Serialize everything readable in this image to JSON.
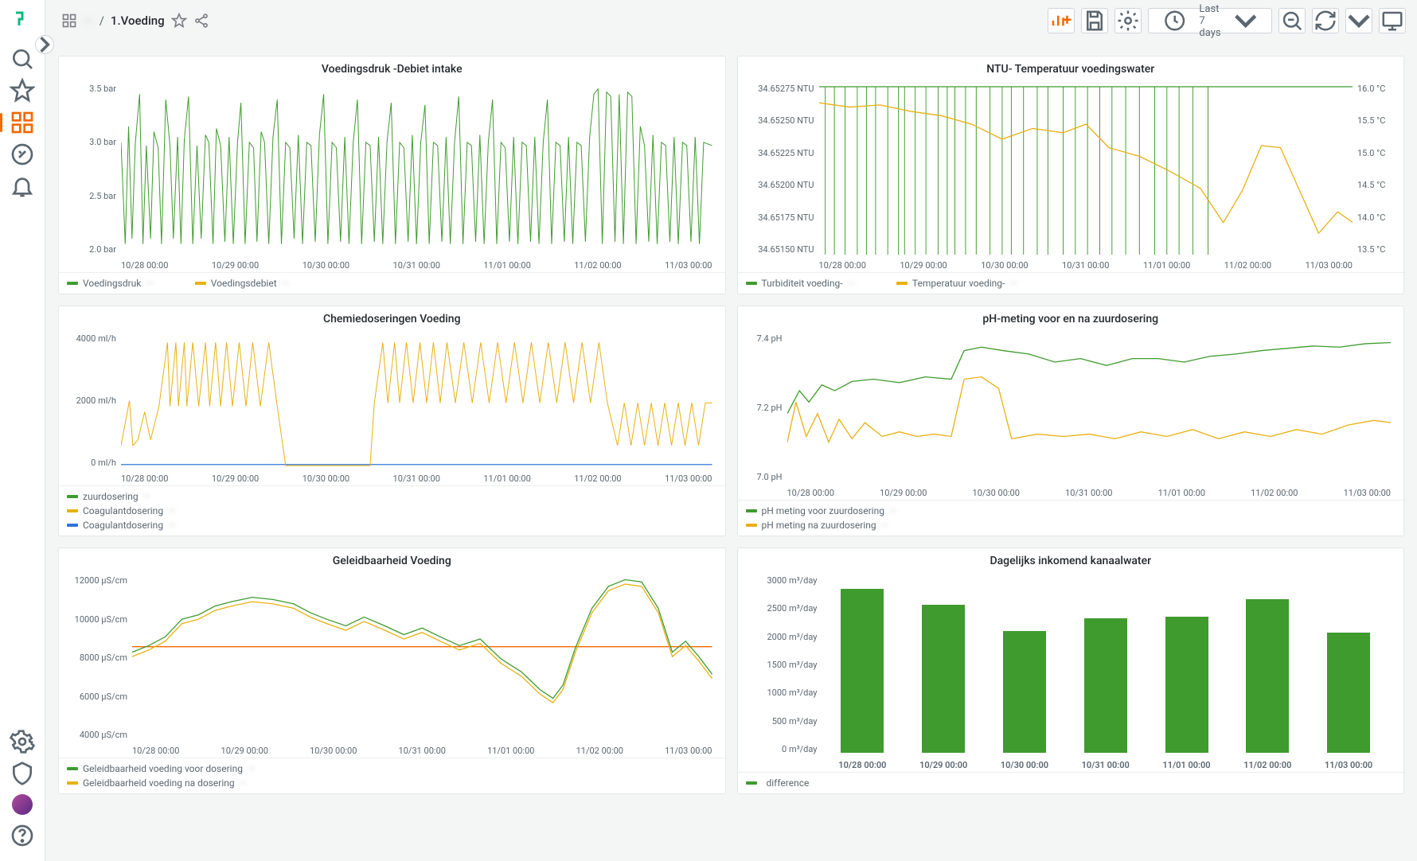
{
  "app": {
    "breadcrumb_root": "Dashboards",
    "breadcrumb_parent": "—",
    "breadcrumb_title": "1.Voeding"
  },
  "toolbar": {
    "time_label": "Last 7 days"
  },
  "sidebar": {
    "items": [
      "search",
      "favorites",
      "dashboards",
      "explore",
      "alerts"
    ],
    "bottom": [
      "admin",
      "shield",
      "profile",
      "help"
    ]
  },
  "x_ticks": [
    "10/28 00:00",
    "10/29 00:00",
    "10/30 00:00",
    "10/31 00:00",
    "11/01 00:00",
    "11/02 00:00",
    "11/03 00:00"
  ],
  "panels": {
    "p1": {
      "title": "Voedingsdruk -Debiet intake",
      "y_ticks": [
        "3.5 bar",
        "3.0 bar",
        "2.5 bar",
        "2.0 bar"
      ],
      "legend": [
        {
          "color": "#3f9b2e",
          "label": "Voedingsdruk",
          "suffix": "—"
        },
        {
          "color": "#e8b012",
          "label": "Voedingsdebiet",
          "suffix": "—"
        }
      ]
    },
    "p2": {
      "title": "NTU- Temperatuur voedingswater",
      "y_ticks_left": [
        "34.65275 NTU",
        "34.65250 NTU",
        "34.65225 NTU",
        "34.65200 NTU",
        "34.65175 NTU",
        "34.65150 NTU"
      ],
      "y_ticks_right": [
        "16.0 °C",
        "15.5 °C",
        "15.0 °C",
        "14.5 °C",
        "14.0 °C",
        "13.5 °C"
      ],
      "legend": [
        {
          "color": "#3f9b2e",
          "label": "Turbiditeit voeding-",
          "suffix": "—"
        },
        {
          "color": "#e8b012",
          "label": "Temperatuur voeding-",
          "suffix": "—"
        }
      ]
    },
    "p3": {
      "title": "Chemiedoseringen Voeding",
      "y_ticks": [
        "4000 ml/h",
        "2000 ml/h",
        "0 ml/h"
      ],
      "legend": [
        {
          "color": "#3f9b2e",
          "label": "zuurdosering",
          "suffix": "—"
        },
        {
          "color": "#e8b012",
          "label": "Coagulantdosering",
          "suffix": "—"
        },
        {
          "color": "#3274d9",
          "label": "Coagulantdosering",
          "suffix": "—"
        }
      ]
    },
    "p4": {
      "title": "pH-meting voor en na zuurdosering",
      "y_ticks": [
        "7.4 pH",
        "7.2 pH",
        "7.0 pH"
      ],
      "legend": [
        {
          "color": "#3f9b2e",
          "label": "pH meting voor zuurdosering",
          "suffix": "—"
        },
        {
          "color": "#e8b012",
          "label": "pH meting na zuurdosering",
          "suffix": "—"
        }
      ]
    },
    "p5": {
      "title": "Geleidbaarheid Voeding",
      "y_ticks": [
        "12000 μS/cm",
        "10000 μS/cm",
        "8000 μS/cm",
        "6000 μS/cm",
        "4000 μS/cm"
      ],
      "legend": [
        {
          "color": "#3f9b2e",
          "label": "Geleidbaarheid voeding voor dosering",
          "suffix": "—"
        },
        {
          "color": "#e8b012",
          "label": "Geleidbaarheid voeding na dosering",
          "suffix": "—"
        }
      ]
    },
    "p6": {
      "title": "Dagelijks inkomend kanaalwater",
      "y_ticks": [
        "3000 m³/day",
        "2500 m³/day",
        "2000 m³/day",
        "1500 m³/day",
        "1000 m³/day",
        "500 m³/day",
        "0 m³/day"
      ],
      "legend": [
        {
          "color": "#3f9b2e",
          "label": "",
          "suffix": "difference"
        }
      ]
    }
  },
  "chart_data": [
    {
      "id": "p1",
      "type": "line",
      "title": "Voedingsdruk -Debiet intake",
      "xlabel": "",
      "ylabel": "bar",
      "ylim": [
        2.0,
        3.5
      ],
      "x_categories": [
        "10/28 00:00",
        "10/29 00:00",
        "10/30 00:00",
        "10/31 00:00",
        "11/01 00:00",
        "11/02 00:00",
        "11/03 00:00"
      ],
      "series": [
        {
          "name": "Voedingsdruk",
          "color": "#3f9b2e",
          "note": "high-frequency pressure data oscillating mostly 2.3–3.2 bar",
          "daily_mean": [
            2.9,
            3.0,
            3.0,
            2.9,
            3.0,
            3.1,
            3.0
          ]
        },
        {
          "name": "Voedingsdebiet",
          "color": "#e8b012",
          "note": "overlaid flow signal, largely flat"
        }
      ]
    },
    {
      "id": "p2",
      "type": "line",
      "title": "NTU- Temperatuur voedingswater",
      "x_categories": [
        "10/28 00:00",
        "10/29 00:00",
        "10/30 00:00",
        "10/31 00:00",
        "11/01 00:00",
        "11/02 00:00",
        "11/03 00:00"
      ],
      "axes": [
        {
          "side": "left",
          "label": "NTU",
          "lim": [
            34.6515,
            34.6528
          ]
        },
        {
          "side": "right",
          "label": "°C",
          "lim": [
            13.5,
            16.0
          ]
        }
      ],
      "series": [
        {
          "name": "Turbiditeit voeding",
          "axis": "left",
          "color": "#3f9b2e",
          "note": "extremely narrow range ~34.6516–34.6528 NTU with spikes"
        },
        {
          "name": "Temperatuur voeding",
          "axis": "right",
          "color": "#e8b012",
          "daily_approx": [
            15.7,
            15.6,
            15.3,
            15.0,
            15.0,
            14.5,
            14.2,
            13.7
          ]
        }
      ]
    },
    {
      "id": "p3",
      "type": "line",
      "title": "Chemiedoseringen Voeding",
      "ylabel": "ml/h",
      "ylim": [
        0,
        4500
      ],
      "x_categories": [
        "10/28 00:00",
        "10/29 00:00",
        "10/30 00:00",
        "10/31 00:00",
        "11/01 00:00",
        "11/02 00:00",
        "11/03 00:00"
      ],
      "series": [
        {
          "name": "zuurdosering",
          "color": "#3f9b2e"
        },
        {
          "name": "Coagulantdosering",
          "color": "#e8b012",
          "note": "PWM-like switching between ~1000 and ~4200 ml/h; gap on 10/30"
        },
        {
          "name": "Coagulantdosering",
          "color": "#3274d9",
          "note": "mostly 0"
        }
      ]
    },
    {
      "id": "p4",
      "type": "line",
      "title": "pH-meting voor en na zuurdosering",
      "ylabel": "pH",
      "ylim": [
        6.9,
        7.5
      ],
      "x_categories": [
        "10/28 00:00",
        "10/29 00:00",
        "10/30 00:00",
        "10/31 00:00",
        "11/01 00:00",
        "11/02 00:00",
        "11/03 00:00"
      ],
      "series": [
        {
          "name": "pH meting voor zuurdosering",
          "color": "#3f9b2e",
          "daily_approx": [
            7.3,
            7.32,
            7.42,
            7.4,
            7.38,
            7.4,
            7.45,
            7.46
          ]
        },
        {
          "name": "pH meting na zuurdosering",
          "color": "#e8b012",
          "daily_approx": [
            7.1,
            7.08,
            7.25,
            7.05,
            7.05,
            7.05,
            7.07,
            7.1
          ]
        }
      ]
    },
    {
      "id": "p5",
      "type": "line",
      "title": "Geleidbaarheid Voeding",
      "ylabel": "μS/cm",
      "ylim": [
        4000,
        12000
      ],
      "x_categories": [
        "10/28 00:00",
        "10/29 00:00",
        "10/30 00:00",
        "10/31 00:00",
        "11/01 00:00",
        "11/02 00:00",
        "11/03 00:00"
      ],
      "annotations": [
        {
          "type": "hline",
          "y": 8700,
          "color": "#f46800"
        }
      ],
      "series": [
        {
          "name": "Geleidbaarheid voeding voor dosering",
          "color": "#3f9b2e",
          "daily_approx": [
            8800,
            10600,
            10800,
            10100,
            9700,
            8300,
            6200,
            11800,
            8100
          ]
        },
        {
          "name": "Geleidbaarheid voeding na dosering",
          "color": "#e8b012",
          "daily_approx": [
            8700,
            10400,
            10600,
            9900,
            9500,
            8100,
            6100,
            11600,
            7900
          ]
        }
      ]
    },
    {
      "id": "p6",
      "type": "bar",
      "title": "Dagelijks inkomend kanaalwater",
      "ylabel": "m³/day",
      "ylim": [
        0,
        3000
      ],
      "categories": [
        "10/28 00:00",
        "10/29 00:00",
        "10/30 00:00",
        "10/31 00:00",
        "11/01 00:00",
        "11/02 00:00",
        "11/03 00:00"
      ],
      "values": [
        2800,
        2520,
        2080,
        2300,
        2320,
        2620,
        2050
      ],
      "series_name": "difference",
      "color": "#3f9b2e"
    }
  ]
}
